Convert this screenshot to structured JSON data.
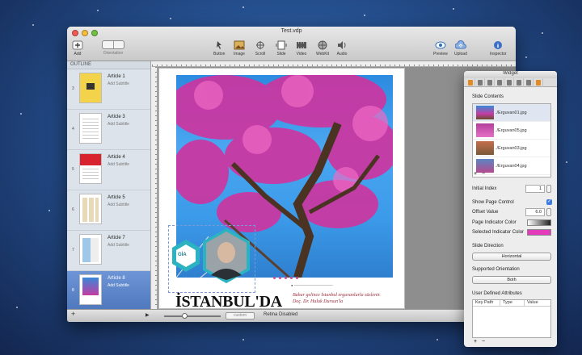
{
  "window": {
    "title": "Test.vdp"
  },
  "toolbar": {
    "add": "Add",
    "orientation": "Orientation",
    "button": "Button",
    "image": "Image",
    "scroll": "Scroll",
    "slide": "Slide",
    "video": "Video",
    "webkit": "WebKit",
    "audio": "Audio",
    "preview": "Preview",
    "upload": "Upload",
    "inspector": "Inspector"
  },
  "sidebar": {
    "header": "OUTLINE",
    "articles": [
      {
        "num": "3",
        "title": "Article 1",
        "subtitle": "Add Subtitle"
      },
      {
        "num": "4",
        "title": "Article 3",
        "subtitle": "Add Subtitle"
      },
      {
        "num": "5",
        "title": "Article 4",
        "subtitle": "Add Subtitle"
      },
      {
        "num": "6",
        "title": "Article 5",
        "subtitle": "Add Subtitle"
      },
      {
        "num": "7",
        "title": "Article 7",
        "subtitle": "Add Subtitle"
      },
      {
        "num": "8",
        "title": "Article 8",
        "subtitle": "Add Subtitle"
      }
    ]
  },
  "page": {
    "headline": "İSTANBUL'DA",
    "lead": "Bahar gelince İstanbul erguvanlarla süslenir. Doç. Dr. Haluk Dursun'la",
    "badge": "GİA"
  },
  "bottombar": {
    "status": "Retina Disabled",
    "zoom_label": "custom"
  },
  "panel": {
    "title": "Widget",
    "slide_contents_label": "Slide Contents",
    "slides": [
      "./Erguvan01.jpg",
      "./Erguvan05.jpg",
      "./Erguvan03.jpg",
      "./Erguvan04.jpg"
    ],
    "initial_index_label": "Initial Index",
    "initial_index": "1",
    "show_page_control_label": "Show Page Control",
    "offset_value_label": "Offset Value",
    "offset_value": "6.0",
    "page_indicator_color_label": "Page Indicator Color",
    "selected_indicator_color_label": "Selected Indicator Color",
    "selected_indicator_color": "#e23ab8",
    "slide_direction_label": "Slide Direction",
    "slide_direction": "Horizontal",
    "supported_orientation_label": "Supported Orientation",
    "supported_orientation": "Both",
    "user_defined_label": "User Defined Attributes",
    "columns": [
      "Key Path",
      "Type",
      "Value"
    ]
  }
}
